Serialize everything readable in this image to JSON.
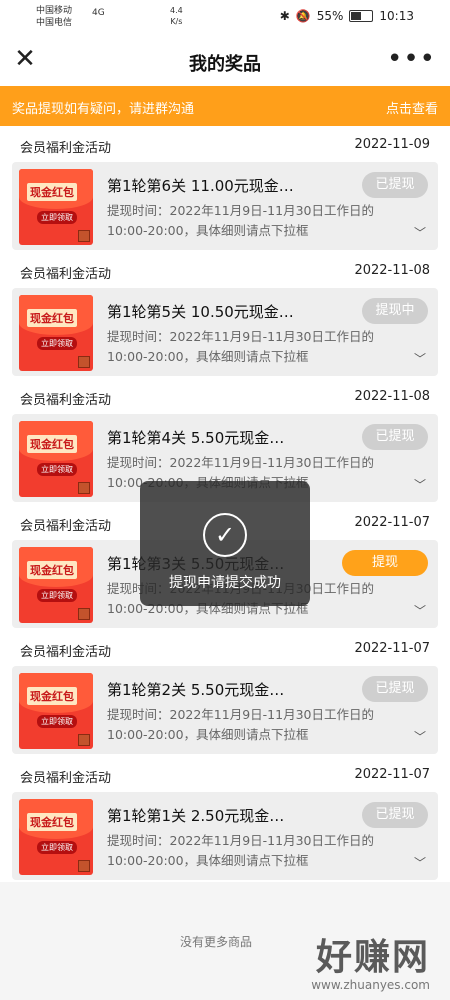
{
  "status_bar": {
    "carrier1": "中国移动",
    "carrier2": "中国电信",
    "network": "4G",
    "speed": "4.4",
    "speed_unit": "K/s",
    "battery": "55%",
    "time": "10:13"
  },
  "app_bar": {
    "title": "我的奖品",
    "close_icon": "close-icon",
    "more_icon": "more-icon"
  },
  "notice": {
    "text": "奖品提现如有疑问，请进群沟通",
    "link": "点击查看"
  },
  "items": [
    {
      "activity": "会员福利金活动",
      "date": "2022-11-09",
      "title": "第1轮第6关 11.00元现金…",
      "desc": "提现时间：2022年11月9日-11月30日工作日的10:00-20:00，具体细则请点下拉框",
      "action": "已提现",
      "action_state": "done"
    },
    {
      "activity": "会员福利金活动",
      "date": "2022-11-08",
      "title": "第1轮第5关 10.50元现金…",
      "desc": "提现时间：2022年11月9日-11月30日工作日的10:00-20:00，具体细则请点下拉框",
      "action": "提现中",
      "action_state": "pending"
    },
    {
      "activity": "会员福利金活动",
      "date": "2022-11-08",
      "title": "第1轮第4关 5.50元现金…",
      "desc": "提现时间：2022年11月9日-11月30日工作日的10:00-20:00，具体细则请点下拉框",
      "action": "已提现",
      "action_state": "done"
    },
    {
      "activity": "会员福利金活动",
      "date": "2022-11-07",
      "title": "第1轮第3关 5.50元现金…",
      "desc": "提现时间：2022年11月9日-11月30日工作日的10:00-20:00，具体细则请点下拉框",
      "action": "提现",
      "action_state": "active"
    },
    {
      "activity": "会员福利金活动",
      "date": "2022-11-07",
      "title": "第1轮第2关 5.50元现金…",
      "desc": "提现时间：2022年11月9日-11月30日工作日的10:00-20:00，具体细则请点下拉框",
      "action": "已提现",
      "action_state": "done"
    },
    {
      "activity": "会员福利金活动",
      "date": "2022-11-07",
      "title": "第1轮第1关 2.50元现金…",
      "desc": "提现时间：2022年11月9日-11月30日工作日的10:00-20:00，具体细则请点下拉框",
      "action": "已提现",
      "action_state": "done"
    }
  ],
  "thumb": {
    "label": "现金红包",
    "button": "立即领取"
  },
  "footer": {
    "end_text": "没有更多商品"
  },
  "toast": {
    "message": "提现申请提交成功"
  },
  "watermark": {
    "text": "好赚网",
    "url": "www.zhuanyes.com"
  },
  "colors": {
    "accent": "#ff9f1a",
    "done_gray": "#cfcfcf",
    "red": "#f23d2e"
  }
}
